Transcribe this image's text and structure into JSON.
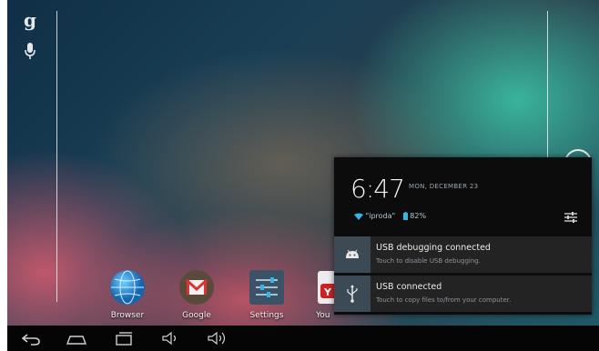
{
  "home": {
    "search_glyph": "g",
    "apps": [
      {
        "label": "Browser",
        "icon": "globe-icon"
      },
      {
        "label": "Google",
        "icon": "gmail-icon"
      },
      {
        "label": "Settings",
        "icon": "settings-sliders-icon"
      },
      {
        "label": "You",
        "icon": "youtube-icon"
      }
    ]
  },
  "notification_panel": {
    "time": "6:47",
    "date": "MON, DECEMBER 23",
    "wifi_name": "\"iproda\"",
    "battery": "82%",
    "notifications": [
      {
        "title": "USB debugging connected",
        "subtitle": "Touch to disable USB debugging.",
        "icon": "android-icon"
      },
      {
        "title": "USB connected",
        "subtitle": "Touch to copy files to/from your computer.",
        "icon": "usb-icon"
      }
    ]
  },
  "nav_bar": [
    "back-icon",
    "home-icon",
    "recent-apps-icon",
    "volume-down-icon",
    "volume-up-icon"
  ],
  "colors": {
    "accent": "#33b5e5",
    "panel": "#0c0c0c",
    "navbar": "#050505"
  }
}
